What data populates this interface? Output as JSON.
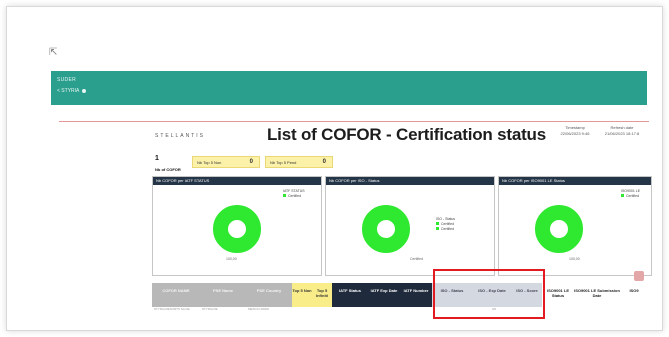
{
  "teal_header": {
    "line1": "SUDER",
    "line2": "< STYRIA"
  },
  "report": {
    "logo": "STELLANTIS",
    "title": "List of COFOR - Certification status",
    "meta_left": [
      "Timestamp",
      "22/06/2023 9:46"
    ],
    "meta_right": [
      "Refresh date",
      "21/06/2023 18:17:8"
    ],
    "count": "1",
    "count_label": "Nb of COFOR",
    "pills": [
      {
        "label": "Nb Top 5 Non",
        "value": "0"
      },
      {
        "label": "Nb Top 5 Pend",
        "value": "0"
      }
    ],
    "cards": [
      {
        "title": "Nb COFOR per IATF STATUS",
        "legend": [
          "IATF STATUS",
          "Certified"
        ],
        "center_label": "100,00"
      },
      {
        "title": "Nb COFOR per ISO - Status",
        "legend": [
          "ISO - Status",
          "Certified",
          "Certified"
        ],
        "center_label": "Certified"
      },
      {
        "title": "Nb COFOR per ISO9001 LE Status",
        "legend": [
          "ISO9001 LE",
          "Certified"
        ],
        "center_label": "100,00"
      }
    ],
    "table_headers": [
      {
        "label": "COFOR NAME",
        "style": "gray"
      },
      {
        "label": "PSE Name",
        "style": "gray"
      },
      {
        "label": "PSE Country",
        "style": "gray"
      },
      {
        "label": "Top 5 Non",
        "style": "yellow"
      },
      {
        "label": "Top 5 Infiniti",
        "style": "yellow"
      },
      {
        "label": "IATF Status",
        "style": "navy"
      },
      {
        "label": "IATF Exp Date",
        "style": "navy"
      },
      {
        "label": "IATF Number",
        "style": "navy"
      },
      {
        "label": "ISO - Status",
        "style": "light"
      },
      {
        "label": "ISO - Exp Date",
        "style": "light"
      },
      {
        "label": "ISO - Score",
        "style": "light"
      },
      {
        "label": "ISO9001 LE Status",
        "style": "white"
      },
      {
        "label": "ISO9001 LE Submission Date",
        "style": "white"
      },
      {
        "label": "ISO9",
        "style": "white"
      }
    ],
    "row_values": [
      "STYRIA RESORTS SA DE",
      "STYRIA DE",
      "MEXICO 06000",
      "",
      "",
      "",
      "",
      "",
      "",
      "0/0",
      "",
      "",
      "",
      ""
    ]
  },
  "colors": {
    "teal": "#2a9f8d",
    "donut_green": "#2fe830",
    "highlight_red": "#e21b23"
  },
  "icons": {
    "corner": "cursor-icon",
    "export": "export-icon"
  }
}
